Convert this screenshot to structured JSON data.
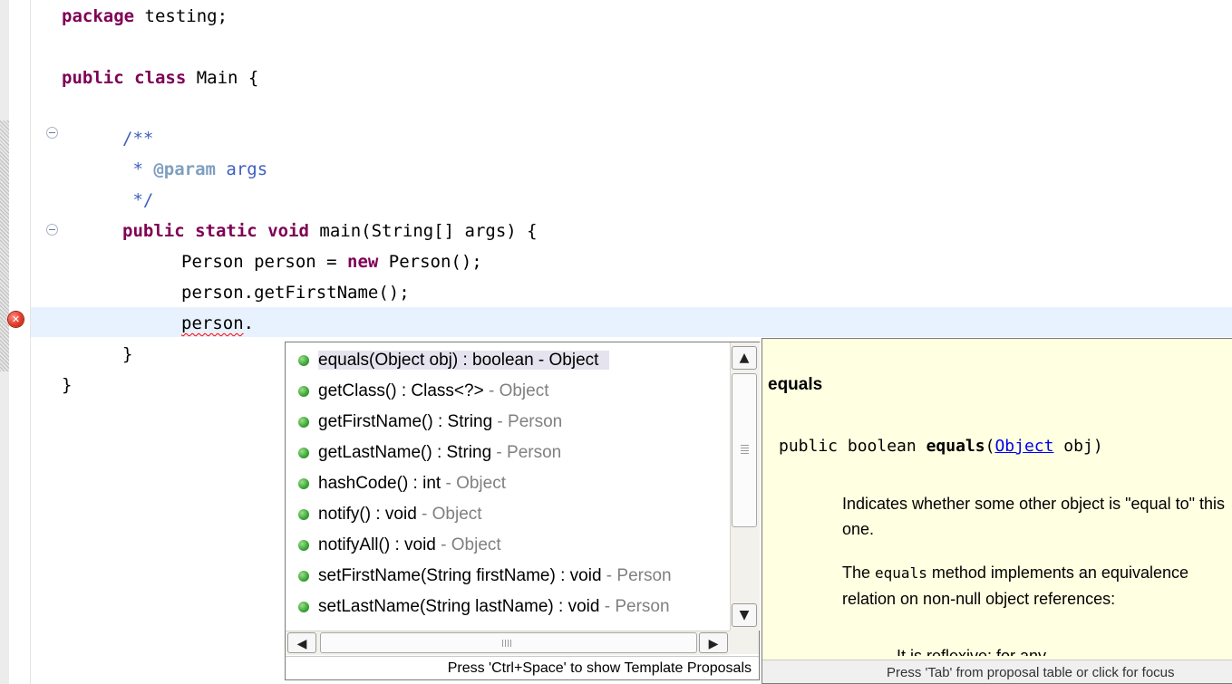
{
  "editor": {
    "lines": {
      "l1_kw": "package",
      "l1_rest": " testing;",
      "l2_kw1": "public",
      "l2_kw2": "class",
      "l2_rest": " Main {",
      "l3": "/**",
      "l4_star": " * ",
      "l4_tag": "@param",
      "l4_arg": " args",
      "l5": " */",
      "l6_kw1": "public",
      "l6_kw2": "static",
      "l6_kw3": "void",
      "l6_rest": " main(String[] args) {",
      "l7_a": "Person person = ",
      "l7_kw": "new",
      "l7_b": " Person();",
      "l8": "person.getFirstName();",
      "l9_err": "person",
      "l9_dot": ".",
      "l10": "}",
      "l11": "}"
    },
    "error_icon": "error-x-icon",
    "error_glyph": "✕"
  },
  "proposals": {
    "items": [
      {
        "main": "equals(Object obj) : boolean - Object",
        "owner": ""
      },
      {
        "main": "getClass() : Class<?>",
        "owner": " - Object"
      },
      {
        "main": "getFirstName() : String",
        "owner": " - Person"
      },
      {
        "main": "getLastName() : String",
        "owner": " - Person"
      },
      {
        "main": "hashCode() : int",
        "owner": " - Object"
      },
      {
        "main": "notify() : void",
        "owner": " - Object"
      },
      {
        "main": "notifyAll() : void",
        "owner": " - Object"
      },
      {
        "main": "setFirstName(String firstName) : void",
        "owner": " - Person"
      },
      {
        "main": "setLastName(String lastName) : void",
        "owner": " - Person"
      }
    ],
    "scroll_up": "▲",
    "scroll_down": "▼",
    "scroll_left": "◀",
    "scroll_right": "▶",
    "status": "Press 'Ctrl+Space' to show Template Proposals"
  },
  "doc": {
    "title": "equals",
    "sig_a": "public boolean ",
    "sig_name": "equals",
    "sig_paren": "(",
    "sig_link": "Object",
    "sig_b": " obj)",
    "p1": "Indicates whether some other object is \"equal to\" this one.",
    "p2_a": "The ",
    "p2_code": "equals",
    "p2_b": " method implements an equivalence relation on non-null object references:",
    "cut": "It is reflexive: for any non-null",
    "status": "Press 'Tab' from proposal table or click for focus"
  }
}
